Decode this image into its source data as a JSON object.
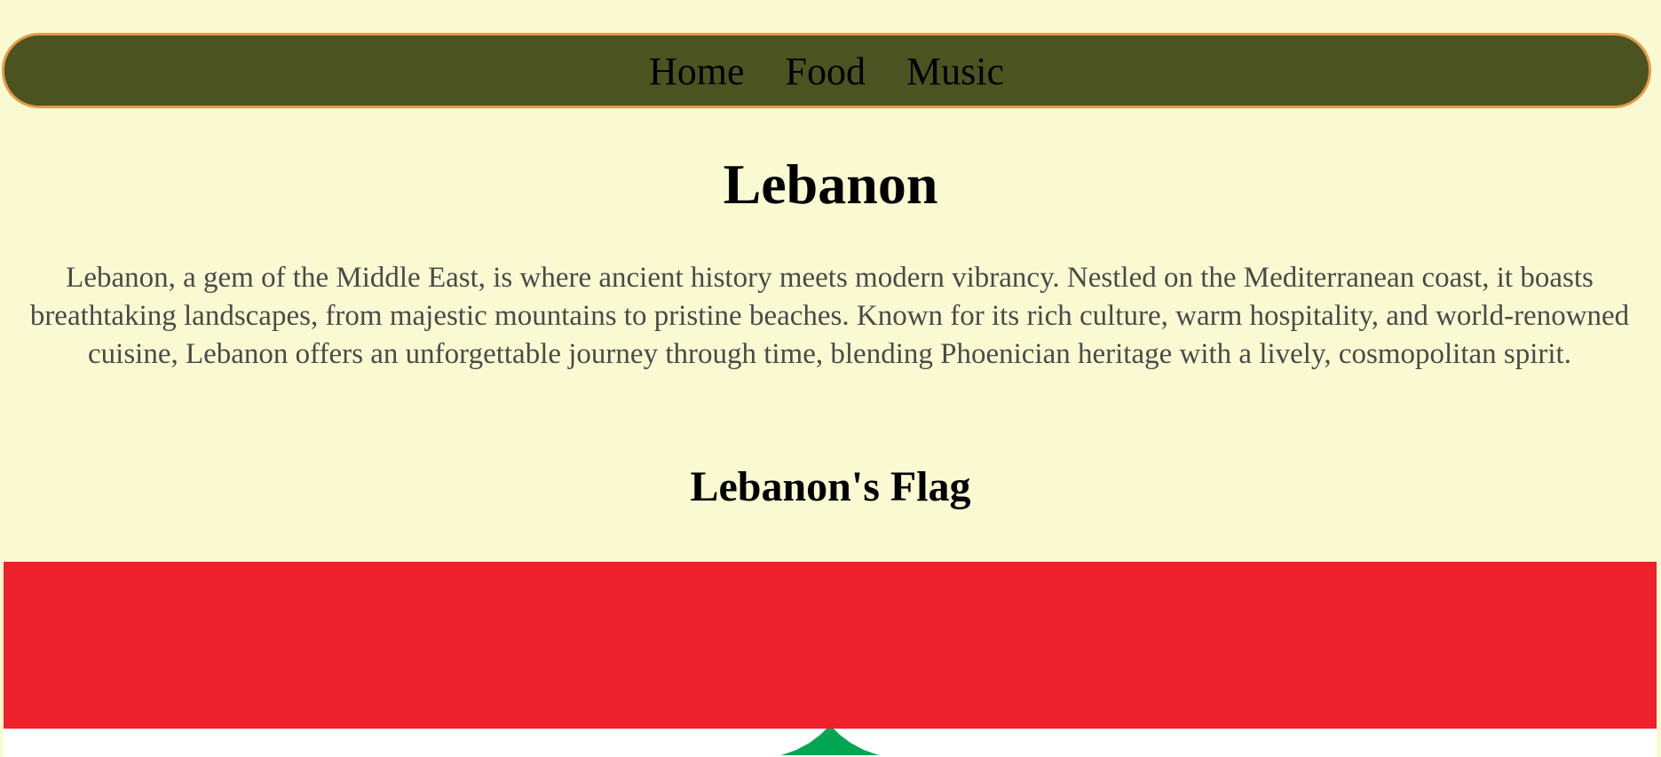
{
  "nav": {
    "items": [
      {
        "label": "Home"
      },
      {
        "label": "Food"
      },
      {
        "label": "Music"
      }
    ]
  },
  "main": {
    "title": "Lebanon",
    "intro": "Lebanon, a gem of the Middle East, is where ancient history meets modern vibrancy. Nestled on the Mediterranean coast, it boasts breathtaking landscapes, from majestic mountains to pristine beaches. Known for its rich culture, warm hospitality, and world-renowned cuisine, Lebanon offers an unforgettable journey through time, blending Phoenician heritage with a lively, cosmopolitan spirit.",
    "flag_heading": "Lebanon's Flag"
  },
  "colors": {
    "background": "#fafad2",
    "navbar": "#4b5320",
    "navbar_border": "#e39b4a",
    "flag_red": "#ed202b",
    "flag_white": "#ffffff",
    "cedar_green": "#00a651"
  },
  "flag": {
    "icon": "cedar-tree-icon"
  }
}
